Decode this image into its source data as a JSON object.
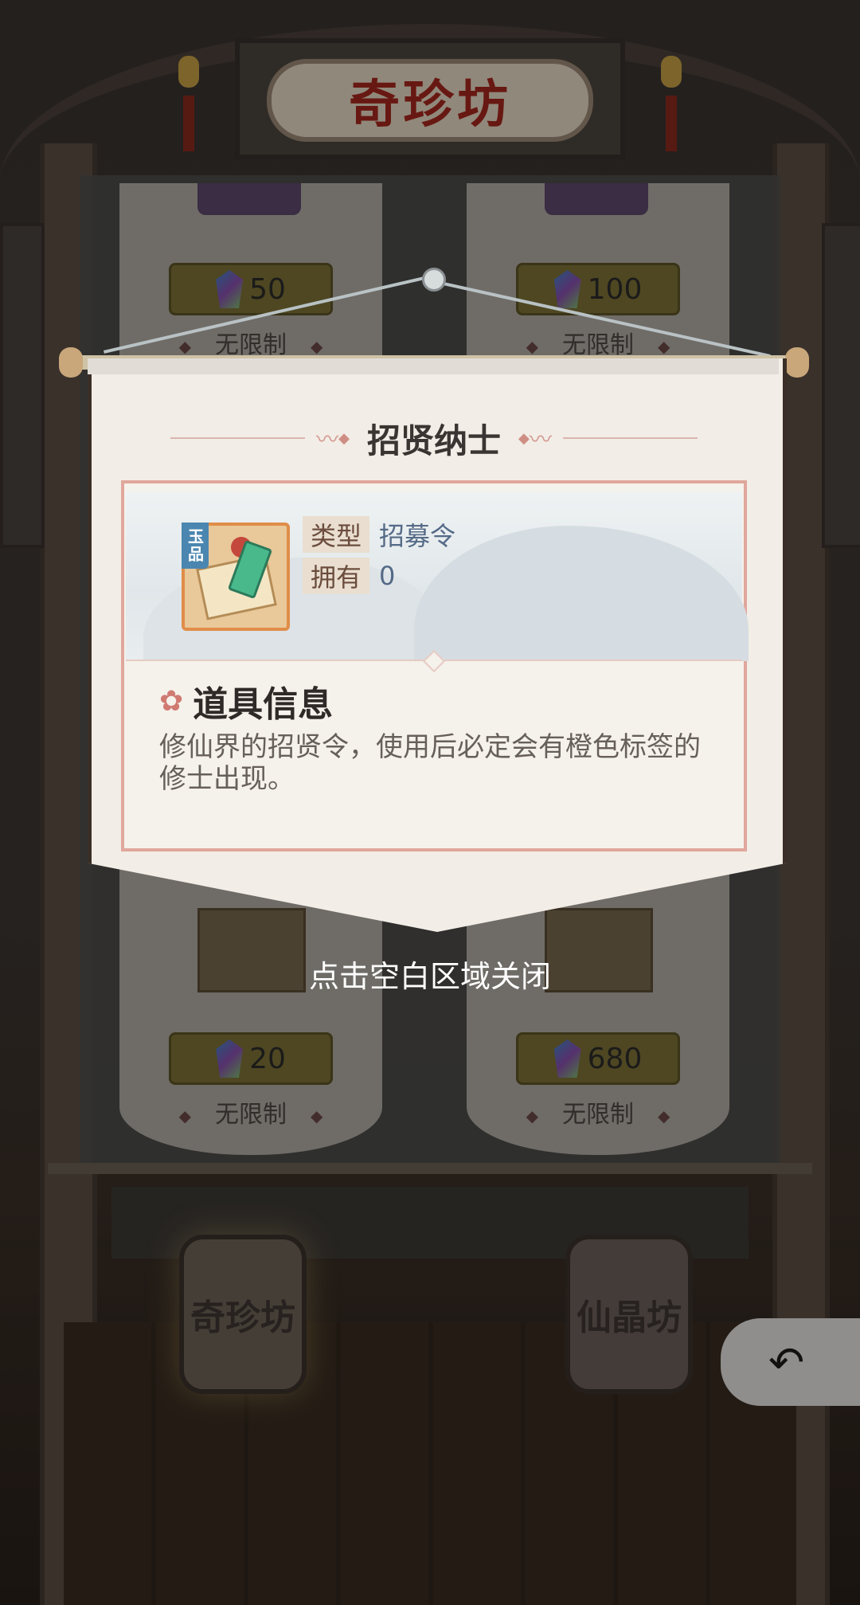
{
  "shop": {
    "title": "奇珍坊",
    "items": [
      {
        "price": "50",
        "limit": "无限制"
      },
      {
        "price": "100",
        "limit": "无限制"
      },
      {
        "price": "20",
        "limit": "无限制"
      },
      {
        "price": "680",
        "limit": "无限制"
      }
    ],
    "tabs": [
      {
        "label": "奇珍坊",
        "active": true
      },
      {
        "label": "仙晶坊",
        "active": false
      }
    ],
    "back_icon": "back-arrow-icon",
    "currency_icon": "spirit-crystal-icon"
  },
  "popup": {
    "title": "招贤纳士",
    "item": {
      "grade": "玉品",
      "icon": "recruit-token-icon",
      "type_label": "类型",
      "type_value": "招募令",
      "owned_label": "拥有",
      "owned_value": "0"
    },
    "info_title": "道具信息",
    "description": "修仙界的招贤令，使用后必定会有橙色标签的修士出现。",
    "close_hint": "点击空白区域关闭"
  },
  "colors": {
    "accent_red": "#a9281d",
    "card_border": "#e0a79c",
    "value_blue": "#546a87",
    "grade_blue": "#4b86b0"
  }
}
